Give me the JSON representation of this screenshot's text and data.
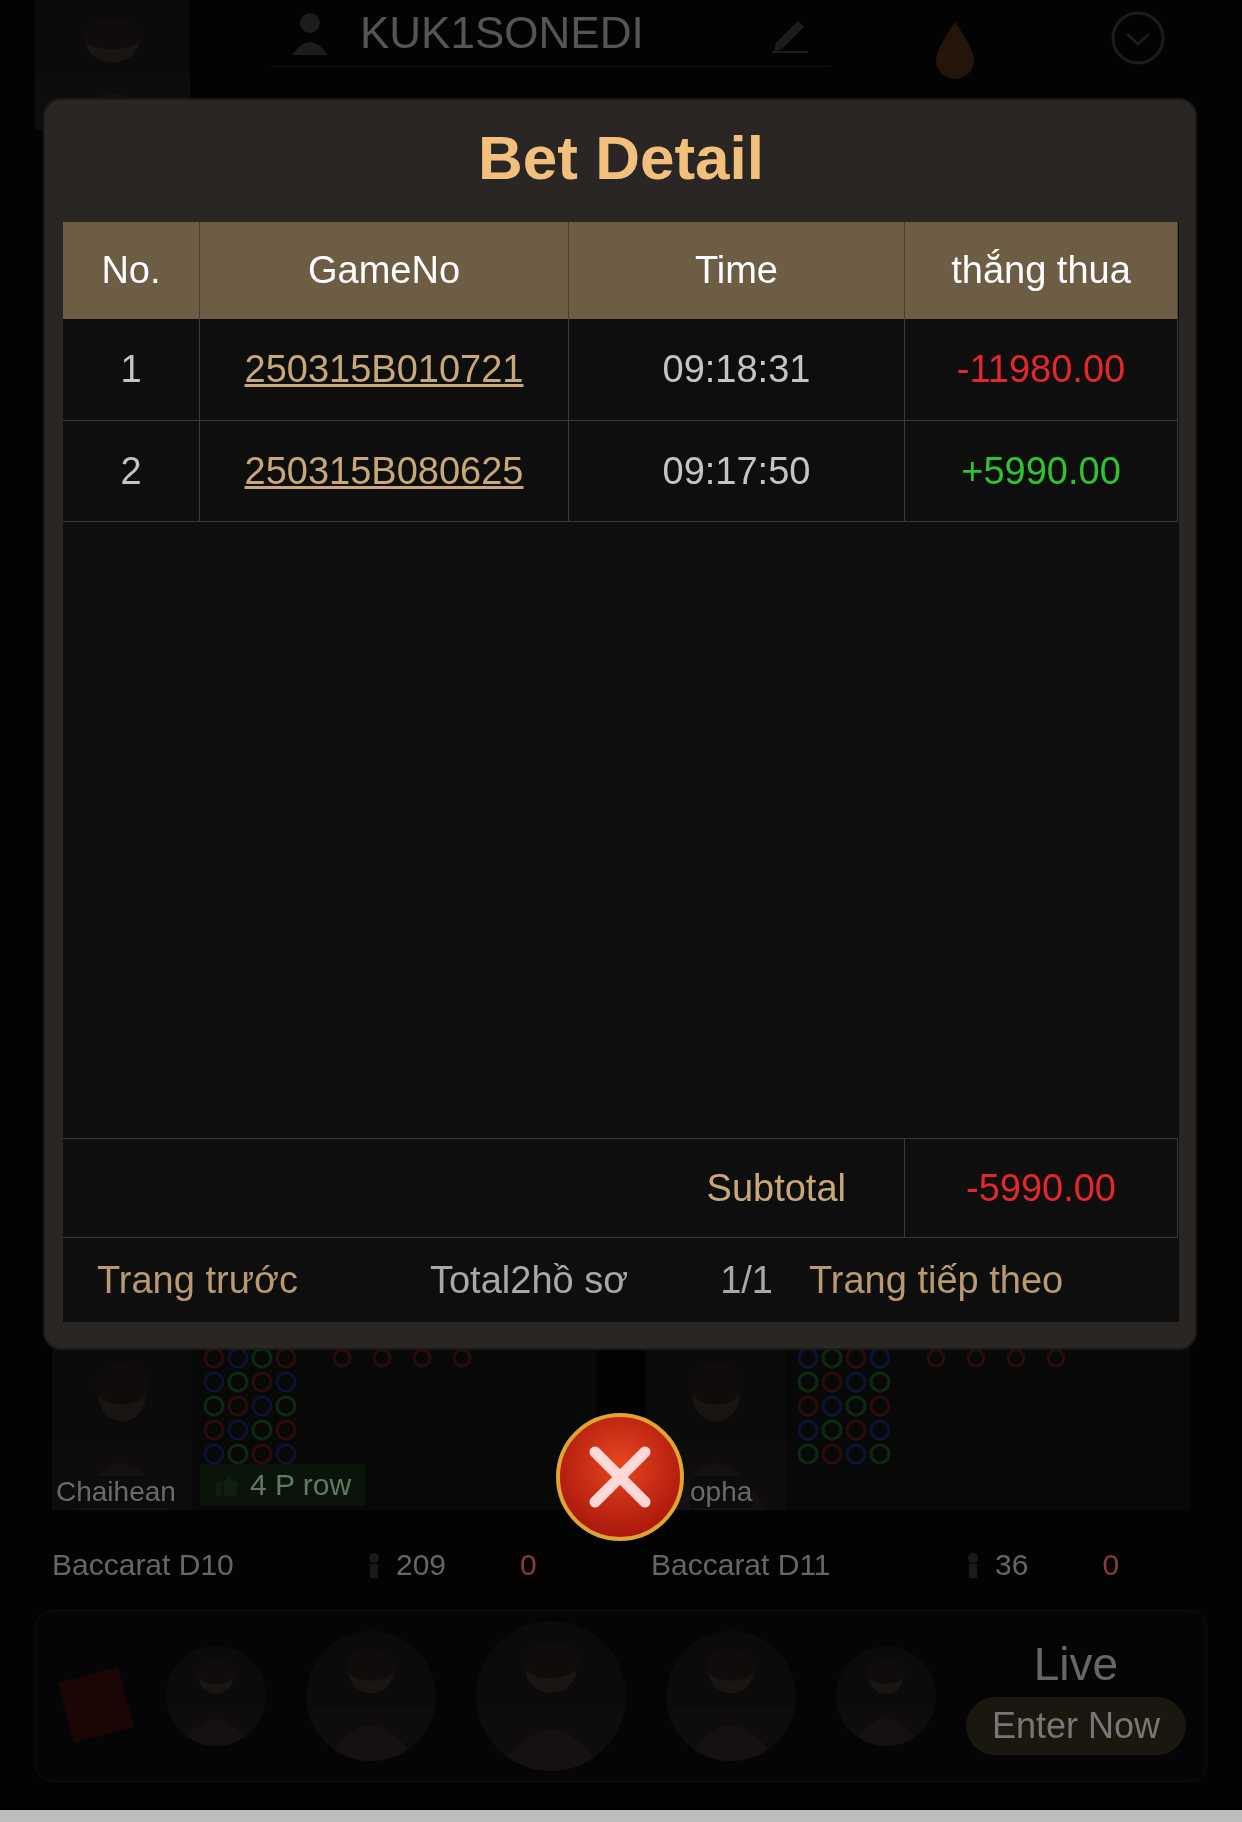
{
  "background": {
    "username": "KUK1SONEDI",
    "tables": [
      {
        "dealer": "Chaihean",
        "badge": "4 P row"
      },
      {
        "dealer": "opha"
      }
    ],
    "rooms": [
      {
        "name": "Baccarat D10",
        "players": "209",
        "extra": "0"
      },
      {
        "name": "Baccarat D11",
        "players": "36",
        "extra": "0"
      }
    ],
    "live": {
      "title": "Live",
      "button": "Enter Now"
    }
  },
  "dialog": {
    "title": "Bet Detail",
    "columns": [
      "No.",
      "GameNo",
      "Time",
      "thắng thua"
    ],
    "rows": [
      {
        "no": "1",
        "game_no": "250315B010721",
        "time": "09:18:31",
        "result": "-11980.00",
        "kind": "loss"
      },
      {
        "no": "2",
        "game_no": "250315B080625",
        "time": "09:17:50",
        "result": "+5990.00",
        "kind": "win"
      }
    ],
    "subtotal": {
      "label": "Subtotal",
      "value": "-5990.00",
      "kind": "loss"
    },
    "pager": {
      "prev": "Trang trước",
      "total": "Total2hồ sơ",
      "page": "1/1",
      "next": "Trang tiếp theo"
    }
  }
}
